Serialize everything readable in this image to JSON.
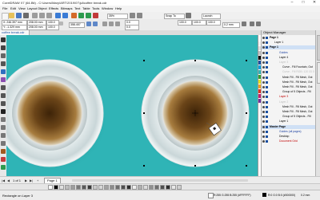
{
  "window": {
    "title": "CorelDRAW X7 (64-Bit) - C:\\Users\\Mary\\ART\\2019\\07\\jul\\coffee break.cdr",
    "controls": [
      "–",
      "□",
      "✕"
    ]
  },
  "menu": [
    "File",
    "Edit",
    "View",
    "Layout",
    "Object",
    "Effects",
    "Bitmaps",
    "Text",
    "Table",
    "Tools",
    "Window",
    "Help"
  ],
  "toolbar": {
    "zoom": "35%",
    "snap_to": "Snap To",
    "launch": "Launch"
  },
  "propbar": {
    "x": "X: 246.397 mm",
    "y": "Y: -1.329 mm",
    "w": "208.00 mm",
    "h": "208.00 mm",
    "scale_w": "100.0",
    "scale_h": "100.0",
    "angle": "358.457",
    "outline_w": "0.2 mm",
    "size_w": "0.0",
    "size_h": "0.0",
    "pct1": "100.0",
    "pct2": "100.0",
    "pct3": "100.0"
  },
  "doc_tab": "coffee break.cdr",
  "object_manager": {
    "title": "Object Manager",
    "rows": [
      {
        "label": "Page 1",
        "indent": 2,
        "color": "#000000",
        "bold": true
      },
      {
        "label": "Layer 1",
        "indent": 8,
        "color": "#000000",
        "bold": false
      },
      {
        "label": "Page 1",
        "indent": 2,
        "color": "#000000",
        "bold": true,
        "selected": true
      },
      {
        "label": "Guides",
        "indent": 14,
        "color": "#1a3fa0",
        "bold": false
      },
      {
        "label": "Layer 4",
        "indent": 14,
        "color": "#000000",
        "bold": false
      },
      {
        "label": "Layer 3",
        "indent": 14,
        "color": "#bdbdbd",
        "bold": false
      },
      {
        "label": "Curve - Fill Fountain, Out",
        "indent": 18,
        "color": "#000000",
        "bold": false
      },
      {
        "label": "Curve - Fill RGB: 120 33 0",
        "indent": 18,
        "color": "#bdbdbd",
        "bold": false
      },
      {
        "label": "Mesh Fill - Fill Mesh, Out",
        "indent": 18,
        "color": "#000000",
        "bold": false
      },
      {
        "label": "Mesh Fill - Fill Mesh, Out",
        "indent": 18,
        "color": "#000000",
        "bold": false
      },
      {
        "label": "Mesh Fill - Fill Mesh, Out",
        "indent": 18,
        "color": "#000000",
        "bold": false
      },
      {
        "label": "Group of 5 Objects - Fill",
        "indent": 18,
        "color": "#000000",
        "bold": false
      },
      {
        "label": "Layer 3",
        "indent": 14,
        "color": "#c00000",
        "bold": false
      },
      {
        "label": "Layer 2",
        "indent": 14,
        "color": "#bdbdbd",
        "bold": false
      },
      {
        "label": "Mesh Fill - Fill Mesh, Out",
        "indent": 18,
        "color": "#000000",
        "bold": false
      },
      {
        "label": "Mesh Fill - Fill Mesh, Out",
        "indent": 18,
        "color": "#000000",
        "bold": false
      },
      {
        "label": "Group of 5 Objects - Fill",
        "indent": 18,
        "color": "#000000",
        "bold": false
      },
      {
        "label": "Layer 1",
        "indent": 14,
        "color": "#000000",
        "bold": false
      },
      {
        "label": "Master Page",
        "indent": 2,
        "color": "#000000",
        "bold": true,
        "selected": true
      },
      {
        "label": "Guides (all pages)",
        "indent": 14,
        "color": "#1a3fa0",
        "bold": false
      },
      {
        "label": "Desktop",
        "indent": 14,
        "color": "#000000",
        "bold": false
      },
      {
        "label": "Document Grid",
        "indent": 14,
        "color": "#c00000",
        "bold": false
      }
    ]
  },
  "page_nav": {
    "counter": "1 of 1",
    "page_tab": "Page 1"
  },
  "status": {
    "left": "Rectangle on Layer 3",
    "fill": "R:255 G:255 B:255 (#FFFFFF)",
    "outline": "R:0 G:0 B:0 (#000000)",
    "outline_width": "0.2 mm"
  },
  "colors": {
    "canvas_bg": "#2fb4b6",
    "accent": "#1a4fa0"
  },
  "icons": {
    "tools": [
      "pick-tool-icon",
      "shape-tool-icon",
      "crop-tool-icon",
      "zoom-tool-icon",
      "freehand-tool-icon",
      "artistic-media-icon",
      "rectangle-tool-icon",
      "ellipse-tool-icon",
      "polygon-tool-icon",
      "text-tool-icon",
      "parallel-dimension-icon",
      "connector-icon",
      "drop-shadow-icon",
      "transparency-icon",
      "eyedropper-icon",
      "interactive-fill-icon",
      "smart-fill-icon"
    ]
  },
  "palette": [
    "#ffffff",
    "#000000",
    "#e0e0e0",
    "#bdbdbd",
    "#9e9e9e",
    "#7a7a7a",
    "#5a5a5a",
    "#3a3a3a",
    "#c9c9c9",
    "#d7d7d7",
    "#a3a3a3",
    "#8c8c8c",
    "#6e6e6e",
    "#4f4f4f",
    "#2f2f2f",
    "#f0f0f0",
    "#b0b0b0",
    "#dcdcdc",
    "#909090",
    "#707070",
    "#505050",
    "#303030",
    "#e8e8e8",
    "#cfcfcf"
  ],
  "side_palette": [
    "#ffffff",
    "#f4f4f4",
    "#e0e0e0",
    "#c0c0c0",
    "#000000",
    "#1a4fa0",
    "#00a0e0",
    "#2fb4b6",
    "#30a030",
    "#e0e020",
    "#f0a020",
    "#e03020",
    "#c02070",
    "#7030a0"
  ]
}
